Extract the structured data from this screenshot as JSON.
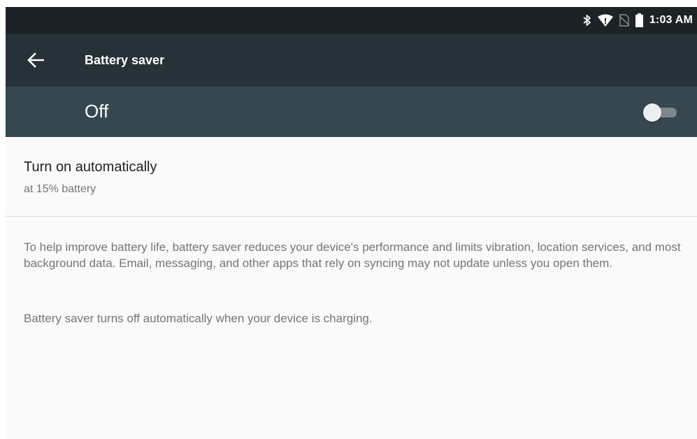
{
  "status_bar": {
    "time": "1:03 AM",
    "icons": [
      "bluetooth-icon",
      "wifi-icon",
      "no-sim-icon",
      "battery-icon"
    ]
  },
  "toolbar": {
    "back_icon": "arrow-back-icon",
    "title": "Battery saver"
  },
  "master_switch": {
    "label": "Off",
    "checked": false
  },
  "preference": {
    "title": "Turn on automatically",
    "summary": "at 15% battery"
  },
  "footer": {
    "paragraph_1": "To help improve battery life, battery saver reduces your device's performance and limits vibration, location services, and most background data. Email, messaging, and other apps that rely on syncing may not update unless you open them.",
    "paragraph_2": "Battery saver turns off automatically when your device is charging."
  },
  "colors": {
    "status_bar": "#1c2326",
    "toolbar": "#263238",
    "switch_bar": "#37474f",
    "background": "#fafafa"
  }
}
